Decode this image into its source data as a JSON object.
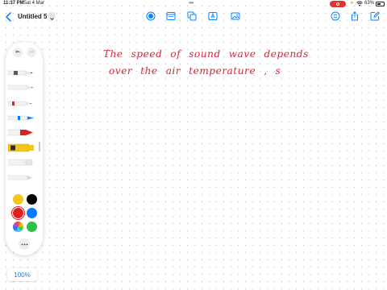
{
  "status_bar": {
    "time": "11:37 PM",
    "date": "Sat 4 Mar",
    "battery_percent": "63%",
    "battery_level": 0.63
  },
  "toolbar": {
    "title": "Untitled 5"
  },
  "canvas": {
    "handwriting_lines": [
      [
        "The",
        "speed",
        "of",
        "sound",
        "wave",
        "depends"
      ],
      [
        "over",
        "the",
        "air",
        "temperature",
        ",",
        "s"
      ]
    ],
    "ink_color": "#d7243b"
  },
  "palette": {
    "colors": {
      "yellow": "#f5c518",
      "black": "#000000",
      "red": "#e02020",
      "blue": "#0a7aff",
      "green": "#30c048"
    },
    "selected_color": "red"
  },
  "zoom": {
    "label": "100%"
  },
  "accent_color": "#0a84ff"
}
